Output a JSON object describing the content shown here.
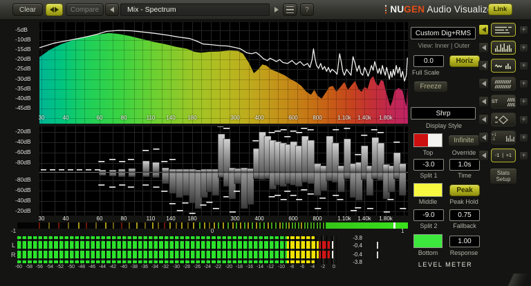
{
  "topbar": {
    "clear": "Clear",
    "compare": "Compare",
    "preset": "Mix - Spectrum",
    "help": "?",
    "logo_nu": "NU",
    "logo_gen": "GEN",
    "logo_rest": "Audio Visualizer",
    "link": "Link"
  },
  "colors": {
    "accent_yellow": "#c9c929",
    "logo_orange": "#e04e16",
    "meter_green": "#2ce22c",
    "meter_yellow": "#f0e200",
    "meter_red": "#d01616"
  },
  "spectrum": {
    "db_labels": [
      "-5dB",
      "-10dB",
      "-15dB",
      "-20dB",
      "-25dB",
      "-30dB",
      "-35dB",
      "-40dB",
      "-45dB"
    ],
    "freq_ticks": [
      [
        30,
        "30"
      ],
      [
        40,
        "40"
      ],
      [
        60,
        "60"
      ],
      [
        80,
        "80"
      ],
      [
        110,
        "110"
      ],
      [
        140,
        "140"
      ],
      [
        180,
        "180"
      ],
      [
        300,
        "300"
      ],
      [
        400,
        "400"
      ],
      [
        600,
        "600"
      ],
      [
        800,
        "800"
      ],
      [
        1100,
        "1.10k"
      ],
      [
        1400,
        "1.40k"
      ],
      [
        1800,
        "1.80k"
      ]
    ],
    "grid_freqs": [
      30,
      35,
      40,
      45,
      50,
      60,
      70,
      80,
      90,
      100,
      110,
      125,
      140,
      160,
      180,
      200,
      225,
      250,
      280,
      315,
      355,
      400,
      450,
      500,
      560,
      630,
      710,
      800,
      900,
      1000,
      1120,
      1250,
      1400,
      1600,
      1800,
      2000,
      2240
    ],
    "gradient": [
      [
        0,
        "#00b496"
      ],
      [
        0.06,
        "#00c480"
      ],
      [
        0.13,
        "#1ecf5a"
      ],
      [
        0.22,
        "#3ad342"
      ],
      [
        0.32,
        "#6fd030"
      ],
      [
        0.42,
        "#9cc626"
      ],
      [
        0.5,
        "#b5bb20"
      ],
      [
        0.58,
        "#c0a81c"
      ],
      [
        0.66,
        "#c48f18"
      ],
      [
        0.73,
        "#c67615"
      ],
      [
        0.79,
        "#c75c16"
      ],
      [
        0.85,
        "#c6421f"
      ],
      [
        0.9,
        "#c33035"
      ],
      [
        0.95,
        "#c1284e"
      ],
      [
        1,
        "#bf2464"
      ]
    ],
    "fill": [
      [
        29,
        -19
      ],
      [
        33,
        -15
      ],
      [
        38,
        -12
      ],
      [
        45,
        -9.5
      ],
      [
        52,
        -8
      ],
      [
        60,
        -7
      ],
      [
        67,
        -6.3
      ],
      [
        75,
        -6.8
      ],
      [
        85,
        -7.8
      ],
      [
        100,
        -9.5
      ],
      [
        115,
        -11
      ],
      [
        130,
        -12
      ],
      [
        150,
        -13.5
      ],
      [
        170,
        -14.5
      ],
      [
        185,
        -16
      ],
      [
        200,
        -16.5
      ],
      [
        220,
        -16
      ],
      [
        250,
        -15.8
      ],
      [
        280,
        -15.3
      ],
      [
        310,
        -15.5
      ],
      [
        330,
        -17
      ],
      [
        355,
        -22
      ],
      [
        375,
        -27
      ],
      [
        395,
        -25
      ],
      [
        415,
        -22.5
      ],
      [
        435,
        -23
      ],
      [
        460,
        -25
      ],
      [
        500,
        -26.5
      ],
      [
        540,
        -28
      ],
      [
        580,
        -30
      ],
      [
        620,
        -31.5
      ],
      [
        660,
        -33.5
      ],
      [
        700,
        -36.5
      ],
      [
        740,
        -38
      ],
      [
        770,
        -35.5
      ],
      [
        800,
        -38.5
      ],
      [
        840,
        -40
      ],
      [
        880,
        -37
      ],
      [
        920,
        -34
      ],
      [
        960,
        -33.5
      ],
      [
        1000,
        -36.5
      ],
      [
        1050,
        -34
      ],
      [
        1100,
        -31.5
      ],
      [
        1150,
        -35.5
      ],
      [
        1200,
        -33
      ],
      [
        1250,
        -31
      ],
      [
        1300,
        -35
      ],
      [
        1350,
        -36.5
      ],
      [
        1400,
        -34
      ],
      [
        1450,
        -35
      ],
      [
        1500,
        -30
      ],
      [
        1550,
        -28.5
      ],
      [
        1600,
        -32
      ],
      [
        1650,
        -33.5
      ],
      [
        1700,
        -30.5
      ],
      [
        1750,
        -31
      ],
      [
        1800,
        -36
      ],
      [
        1850,
        -40
      ],
      [
        1900,
        -44
      ],
      [
        1950,
        -41
      ],
      [
        2000,
        -36
      ],
      [
        2100,
        -34.5
      ],
      [
        2200,
        -36
      ],
      [
        2300,
        -44
      ],
      [
        2330,
        -34
      ]
    ],
    "line": [
      [
        29,
        -14
      ],
      [
        35,
        -11.5
      ],
      [
        42,
        -10
      ],
      [
        50,
        -8.5
      ],
      [
        58,
        -7
      ],
      [
        65,
        -5.5
      ],
      [
        75,
        -5
      ],
      [
        88,
        -5.2
      ],
      [
        100,
        -5.8
      ],
      [
        115,
        -6.5
      ],
      [
        135,
        -7.5
      ],
      [
        155,
        -8.5
      ],
      [
        175,
        -9.2
      ],
      [
        190,
        -10.5
      ],
      [
        205,
        -12
      ],
      [
        225,
        -12.3
      ],
      [
        250,
        -12.8
      ],
      [
        275,
        -13
      ],
      [
        300,
        -13.8
      ],
      [
        320,
        -14.5
      ],
      [
        345,
        -16.5
      ],
      [
        365,
        -17
      ],
      [
        385,
        -16.3
      ],
      [
        400,
        -17.5
      ],
      [
        420,
        -19.5
      ],
      [
        440,
        -20.5
      ],
      [
        455,
        -19.3
      ],
      [
        470,
        -20
      ],
      [
        490,
        -21
      ],
      [
        510,
        -20
      ],
      [
        530,
        -21.5
      ],
      [
        560,
        -22
      ],
      [
        590,
        -20.5
      ],
      [
        620,
        -22.5
      ],
      [
        650,
        -21
      ],
      [
        680,
        -23
      ],
      [
        710,
        -22
      ],
      [
        730,
        -24
      ],
      [
        750,
        -20
      ],
      [
        762,
        -14.5
      ],
      [
        775,
        -19
      ],
      [
        790,
        -23
      ],
      [
        810,
        -24.5
      ],
      [
        830,
        -22
      ],
      [
        850,
        -25
      ],
      [
        870,
        -23.5
      ],
      [
        890,
        -26
      ],
      [
        910,
        -24
      ],
      [
        930,
        -26.5
      ],
      [
        950,
        -25
      ],
      [
        980,
        -26
      ],
      [
        1010,
        -27.5
      ],
      [
        1040,
        -17
      ],
      [
        1060,
        -21
      ],
      [
        1080,
        -26
      ],
      [
        1100,
        -28
      ],
      [
        1130,
        -25
      ],
      [
        1160,
        -26.5
      ],
      [
        1190,
        -28
      ],
      [
        1220,
        -18.5
      ],
      [
        1250,
        -22
      ],
      [
        1280,
        -26
      ],
      [
        1310,
        -23
      ],
      [
        1340,
        -27
      ],
      [
        1370,
        -28
      ],
      [
        1400,
        -24
      ],
      [
        1430,
        -26
      ],
      [
        1460,
        -28.5
      ],
      [
        1490,
        -26
      ],
      [
        1520,
        -23
      ],
      [
        1550,
        -25.5
      ],
      [
        1580,
        -21
      ],
      [
        1610,
        -24
      ],
      [
        1640,
        -27
      ],
      [
        1670,
        -24.5
      ],
      [
        1700,
        -27.5
      ],
      [
        1730,
        -23
      ],
      [
        1760,
        -26
      ],
      [
        1790,
        -28
      ],
      [
        1820,
        -24
      ],
      [
        1850,
        -27
      ],
      [
        1880,
        -30
      ],
      [
        1910,
        -26
      ],
      [
        1940,
        -29
      ],
      [
        1970,
        -25
      ],
      [
        2000,
        -28
      ],
      [
        2040,
        -23
      ],
      [
        2080,
        -27
      ],
      [
        2120,
        -24
      ],
      [
        2160,
        -29
      ],
      [
        2200,
        -26
      ],
      [
        2250,
        -31
      ],
      [
        2300,
        -28
      ],
      [
        2330,
        -19
      ]
    ]
  },
  "split": {
    "db_labels_top": [
      "-20dB",
      "-40dB",
      "-60dB",
      "-80dB"
    ],
    "db_labels_bottom": [
      "-80dB",
      "-60dB",
      "-40dB",
      "-20dB"
    ],
    "bars": [
      [
        62,
        3,
        4
      ],
      [
        70,
        3,
        5
      ],
      [
        78,
        4,
        6
      ],
      [
        88,
        5,
        6
      ],
      [
        104,
        16,
        6
      ],
      [
        117,
        14,
        7
      ],
      [
        131,
        6,
        16
      ],
      [
        143,
        4,
        30
      ],
      [
        155,
        4,
        36
      ],
      [
        168,
        4,
        33
      ],
      [
        181,
        4,
        44
      ],
      [
        194,
        3,
        52
      ],
      [
        208,
        4,
        36
      ],
      [
        222,
        4,
        28
      ],
      [
        238,
        4,
        33
      ],
      [
        255,
        55,
        7
      ],
      [
        272,
        48,
        20
      ],
      [
        290,
        6,
        38
      ],
      [
        310,
        5,
        16
      ],
      [
        335,
        6,
        52
      ],
      [
        360,
        5,
        46
      ],
      [
        388,
        34,
        9
      ],
      [
        415,
        58,
        10
      ],
      [
        442,
        52,
        9
      ],
      [
        470,
        46,
        24
      ],
      [
        500,
        44,
        18
      ],
      [
        532,
        42,
        20
      ],
      [
        566,
        40,
        16
      ],
      [
        602,
        44,
        18
      ],
      [
        640,
        38,
        20
      ],
      [
        690,
        52,
        14
      ],
      [
        740,
        46,
        16
      ],
      [
        800,
        12,
        33
      ],
      [
        860,
        9,
        26
      ],
      [
        925,
        52,
        12
      ],
      [
        990,
        42,
        14
      ],
      [
        1060,
        9,
        28
      ],
      [
        1140,
        48,
        9
      ],
      [
        1225,
        12,
        36
      ],
      [
        1310,
        14,
        40
      ],
      [
        1400,
        38,
        10
      ],
      [
        1490,
        9,
        33
      ],
      [
        1590,
        50,
        9
      ],
      [
        1700,
        42,
        11
      ],
      [
        1815,
        11,
        38
      ],
      [
        1930,
        9,
        28
      ],
      [
        2060,
        28,
        9
      ],
      [
        2200,
        12,
        33
      ]
    ]
  },
  "correlation": {
    "label_neg": "-1",
    "label_zero": "0",
    "label_pos": "1",
    "lines": [
      [
        0.055,
        "a"
      ],
      [
        0.08,
        "b"
      ],
      [
        0.105,
        "a"
      ],
      [
        0.13,
        "b"
      ],
      [
        0.155,
        "y"
      ],
      [
        0.175,
        "a"
      ],
      [
        0.2,
        "b"
      ],
      [
        0.225,
        "y"
      ],
      [
        0.245,
        "b"
      ],
      [
        0.265,
        "a"
      ],
      [
        0.285,
        "b"
      ],
      [
        0.305,
        "y"
      ],
      [
        0.325,
        "b"
      ],
      [
        0.345,
        "y"
      ],
      [
        0.36,
        "b"
      ],
      [
        0.375,
        "a"
      ],
      [
        0.39,
        "y"
      ],
      [
        0.405,
        "b"
      ],
      [
        0.42,
        "y"
      ],
      [
        0.435,
        "b"
      ],
      [
        0.45,
        "y"
      ],
      [
        0.465,
        "g"
      ],
      [
        0.478,
        "y"
      ],
      [
        0.49,
        "b"
      ],
      [
        0.502,
        "y"
      ],
      [
        0.514,
        "g"
      ],
      [
        0.526,
        "y"
      ],
      [
        0.538,
        "g"
      ],
      [
        0.55,
        "y"
      ],
      [
        0.56,
        "g"
      ],
      [
        0.57,
        "y"
      ],
      [
        0.58,
        "g"
      ],
      [
        0.59,
        "y"
      ],
      [
        0.6,
        "g"
      ],
      [
        0.61,
        "y"
      ],
      [
        0.62,
        "g"
      ],
      [
        0.63,
        "g"
      ],
      [
        0.64,
        "y"
      ],
      [
        0.65,
        "g"
      ],
      [
        0.66,
        "g"
      ],
      [
        0.67,
        "y"
      ],
      [
        0.678,
        "g"
      ],
      [
        0.686,
        "g"
      ],
      [
        0.694,
        "y"
      ],
      [
        0.702,
        "g"
      ],
      [
        0.71,
        "g"
      ],
      [
        0.718,
        "g"
      ],
      [
        0.726,
        "y"
      ],
      [
        0.734,
        "g"
      ],
      [
        0.742,
        "g"
      ],
      [
        0.75,
        "g"
      ],
      [
        0.758,
        "g"
      ],
      [
        0.766,
        "g"
      ],
      [
        0.774,
        "g"
      ],
      [
        0.782,
        "g"
      ]
    ],
    "solid_from": 0.79,
    "notch_at": 0.962
  },
  "meter": {
    "label_l": "L",
    "label_r": "R",
    "value_top": "-3.8",
    "value_l": "-0.4",
    "value_r": "-0.4",
    "value_bottom": "-3.8",
    "peak_db": -0.4,
    "rms_db": -3.8,
    "split1_db": -3.0,
    "split2_db": -9.0,
    "min_db": -60,
    "scale": [
      "-60",
      "-58",
      "-56",
      "-54",
      "-52",
      "-50",
      "-48",
      "-46",
      "-44",
      "-42",
      "-40",
      "-38",
      "-36",
      "-34",
      "-32",
      "-30",
      "-28",
      "-26",
      "-24",
      "-22",
      "-20",
      "-18",
      "-16",
      "-14",
      "-12",
      "-10",
      "-8",
      "-6",
      "-4",
      "-2",
      "0"
    ]
  },
  "panel": {
    "mode": "Custom Dig+RMS",
    "view_label": "View: Inner | Outer",
    "fullscale_value": "0.0",
    "horiz_btn": "Horiz",
    "fullscale_label": "Full Scale",
    "freeze_btn": "Freeze",
    "style_value": "Shrp",
    "style_label": "Display Style",
    "top_label": "Top",
    "override_label": "Override",
    "infinite_btn": "Infinite",
    "split1_value": "-3.0",
    "time_value": "1.0s",
    "split1_label": "Split 1",
    "time_label": "Time",
    "middle_label": "Middle",
    "peakhold_label": "Peak Hold",
    "peak_btn": "Peak",
    "split2_value": "-9.0",
    "fallback_value": "0.75",
    "split2_label": "Split 2",
    "fallback_label": "Fallback",
    "response_value": "1.00",
    "bottom_label": "Bottom",
    "response_label": "Response",
    "meter_title": "LEVEL METER"
  },
  "strip": {
    "st_label": "ST",
    "plus_one": "+1",
    "minus_one": "-1",
    "corr_btn_label": "-1  |  +1",
    "stats_line1": "Stats",
    "stats_line2": "Setup"
  }
}
